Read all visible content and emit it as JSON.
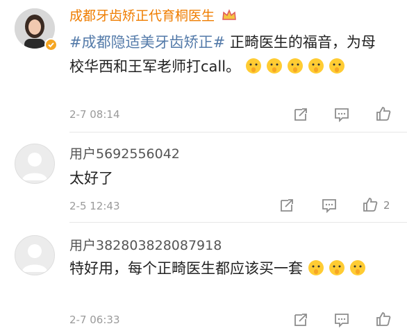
{
  "post": {
    "author": "成都牙齿矫正代育桐医生",
    "text_parts": [
      "#成都隐适美牙齿矫正#",
      " 正畸医生的福音，为母校华西和王军老师打call。"
    ],
    "time": "2-7 08:14"
  },
  "comments": [
    {
      "author": "用户5692556042",
      "text": "太好了",
      "time": "2-5 12:43",
      "likes": "2"
    },
    {
      "author": "用户382803828087918",
      "text": "特好用，每个正畸医生都应该买一套",
      "time": "2-7 06:33"
    }
  ],
  "colors": {
    "author": "#ef7d00",
    "topic_link": "#537aa9",
    "verified_badge": "#f5a623",
    "icon": "#8c8c8c"
  },
  "icons": [
    "verified-badge-icon",
    "crown-icon",
    "repost-icon",
    "comment-icon",
    "like-icon",
    "shushing-face-emoji"
  ]
}
